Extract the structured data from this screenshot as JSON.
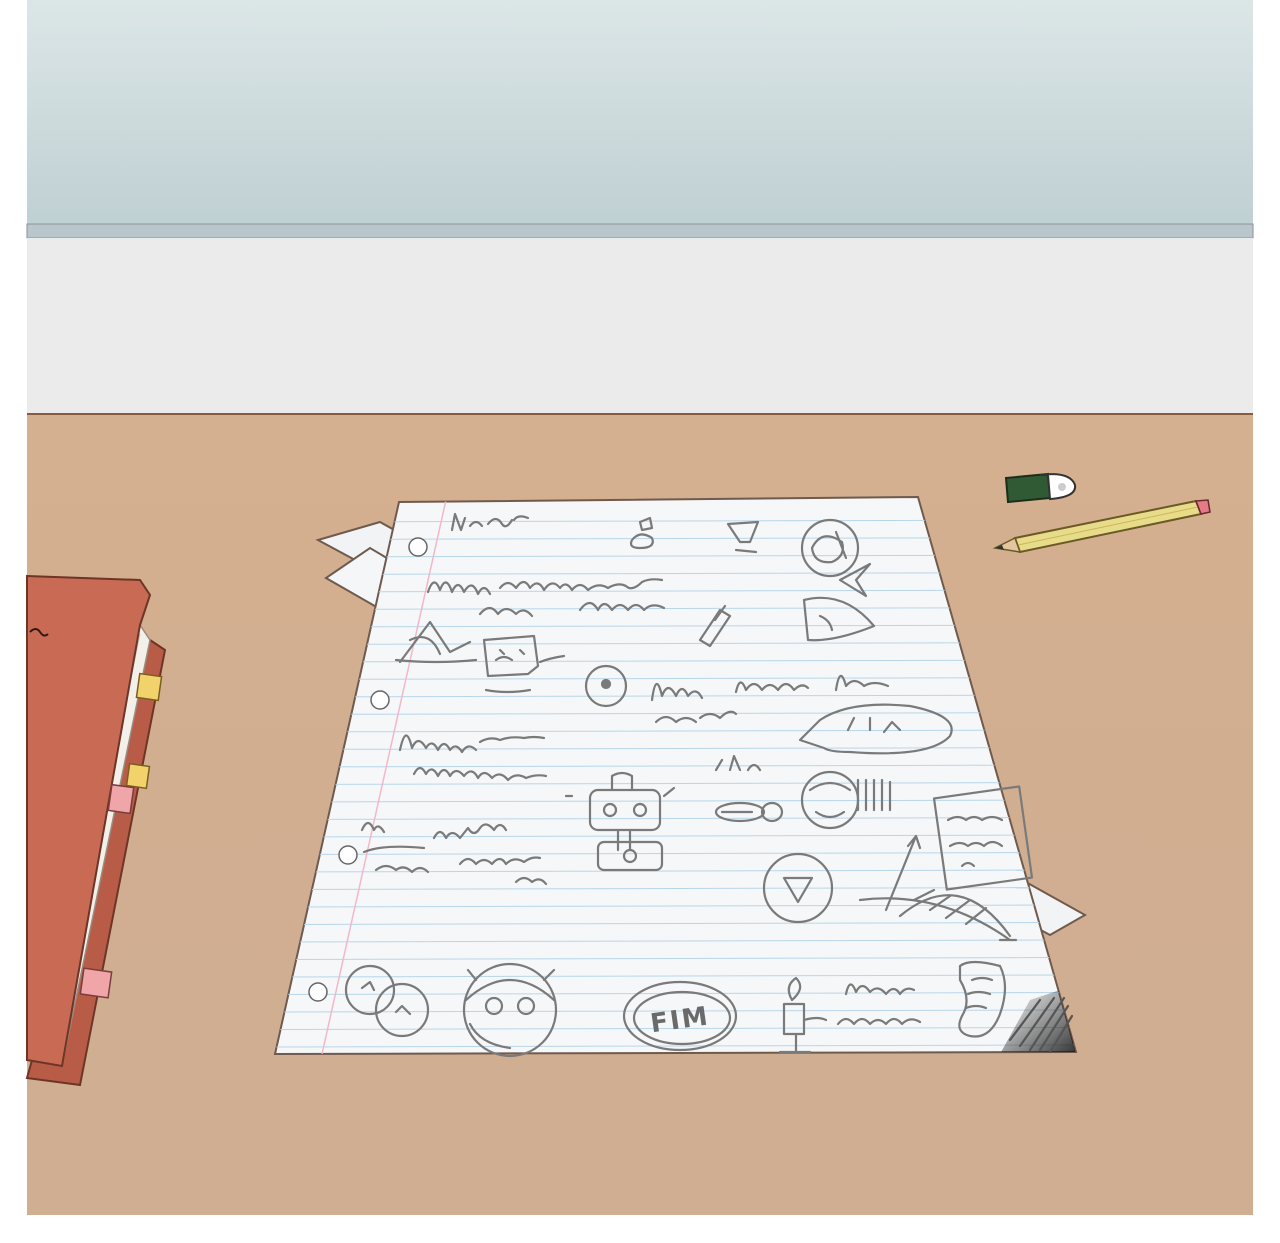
{
  "scene": {
    "description_free": true,
    "sketch_text": "FIM",
    "colors": {
      "window_glass": "#cfdcdd",
      "wall": "#ebebeb",
      "desk": "#d2ae90",
      "paper": "#f6f7f8",
      "ruled_line": "#b8d6ea",
      "margin_line": "#f2b8c8",
      "pencil_stroke": "#7a7a7a",
      "binder": "#c96a55",
      "pencil": "#e8dc8a",
      "eraser": "#2f5a33"
    }
  }
}
